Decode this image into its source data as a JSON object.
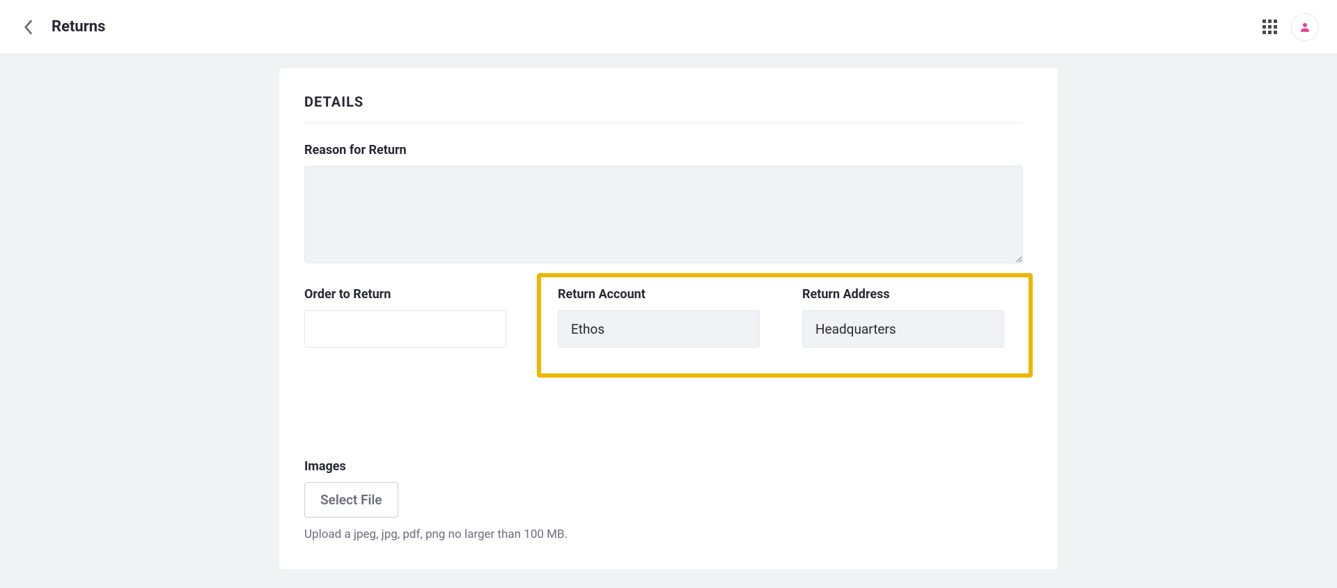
{
  "header": {
    "title": "Returns"
  },
  "form": {
    "section_title": "DETAILS",
    "reason_label": "Reason for Return",
    "reason_value": "",
    "order_label": "Order to Return",
    "order_value": "",
    "account_label": "Return Account",
    "account_value": "Ethos",
    "address_label": "Return Address",
    "address_value": "Headquarters",
    "images_label": "Images",
    "select_file_label": "Select File",
    "upload_hint": "Upload a jpeg, jpg, pdf, png no larger than 100 MB."
  }
}
